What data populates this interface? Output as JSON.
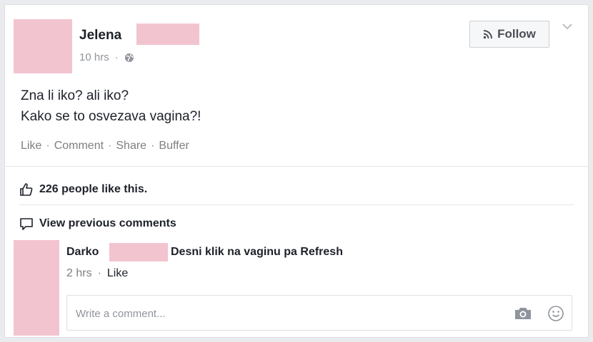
{
  "post": {
    "author_first_name": "Jelena",
    "time": "10 hrs",
    "privacy_icon": "globe-icon",
    "follow_label": "Follow",
    "text_line1": "Zna li iko? ali iko?",
    "text_line2": "Kako se to osvezava vagina?!",
    "actions": {
      "like": "Like",
      "comment": "Comment",
      "share": "Share",
      "buffer": "Buffer",
      "separator": "·"
    }
  },
  "likes": {
    "icon": "thumbs-up-icon",
    "text": "226 people like this."
  },
  "comments": {
    "view_previous_icon": "comment-bubble-icon",
    "view_previous": "View previous comments",
    "items": [
      {
        "author_first_name": "Darko",
        "text": "Desni klik na vaginu pa Refresh",
        "time": "2 hrs",
        "like_label": "Like"
      }
    ],
    "input_placeholder": "Write a comment...",
    "camera_icon": "camera-icon",
    "emoji_icon": "smiley-icon"
  },
  "colors": {
    "redaction": "#f2c4cf",
    "muted_text": "#90949c",
    "background": "#e9ebee"
  }
}
